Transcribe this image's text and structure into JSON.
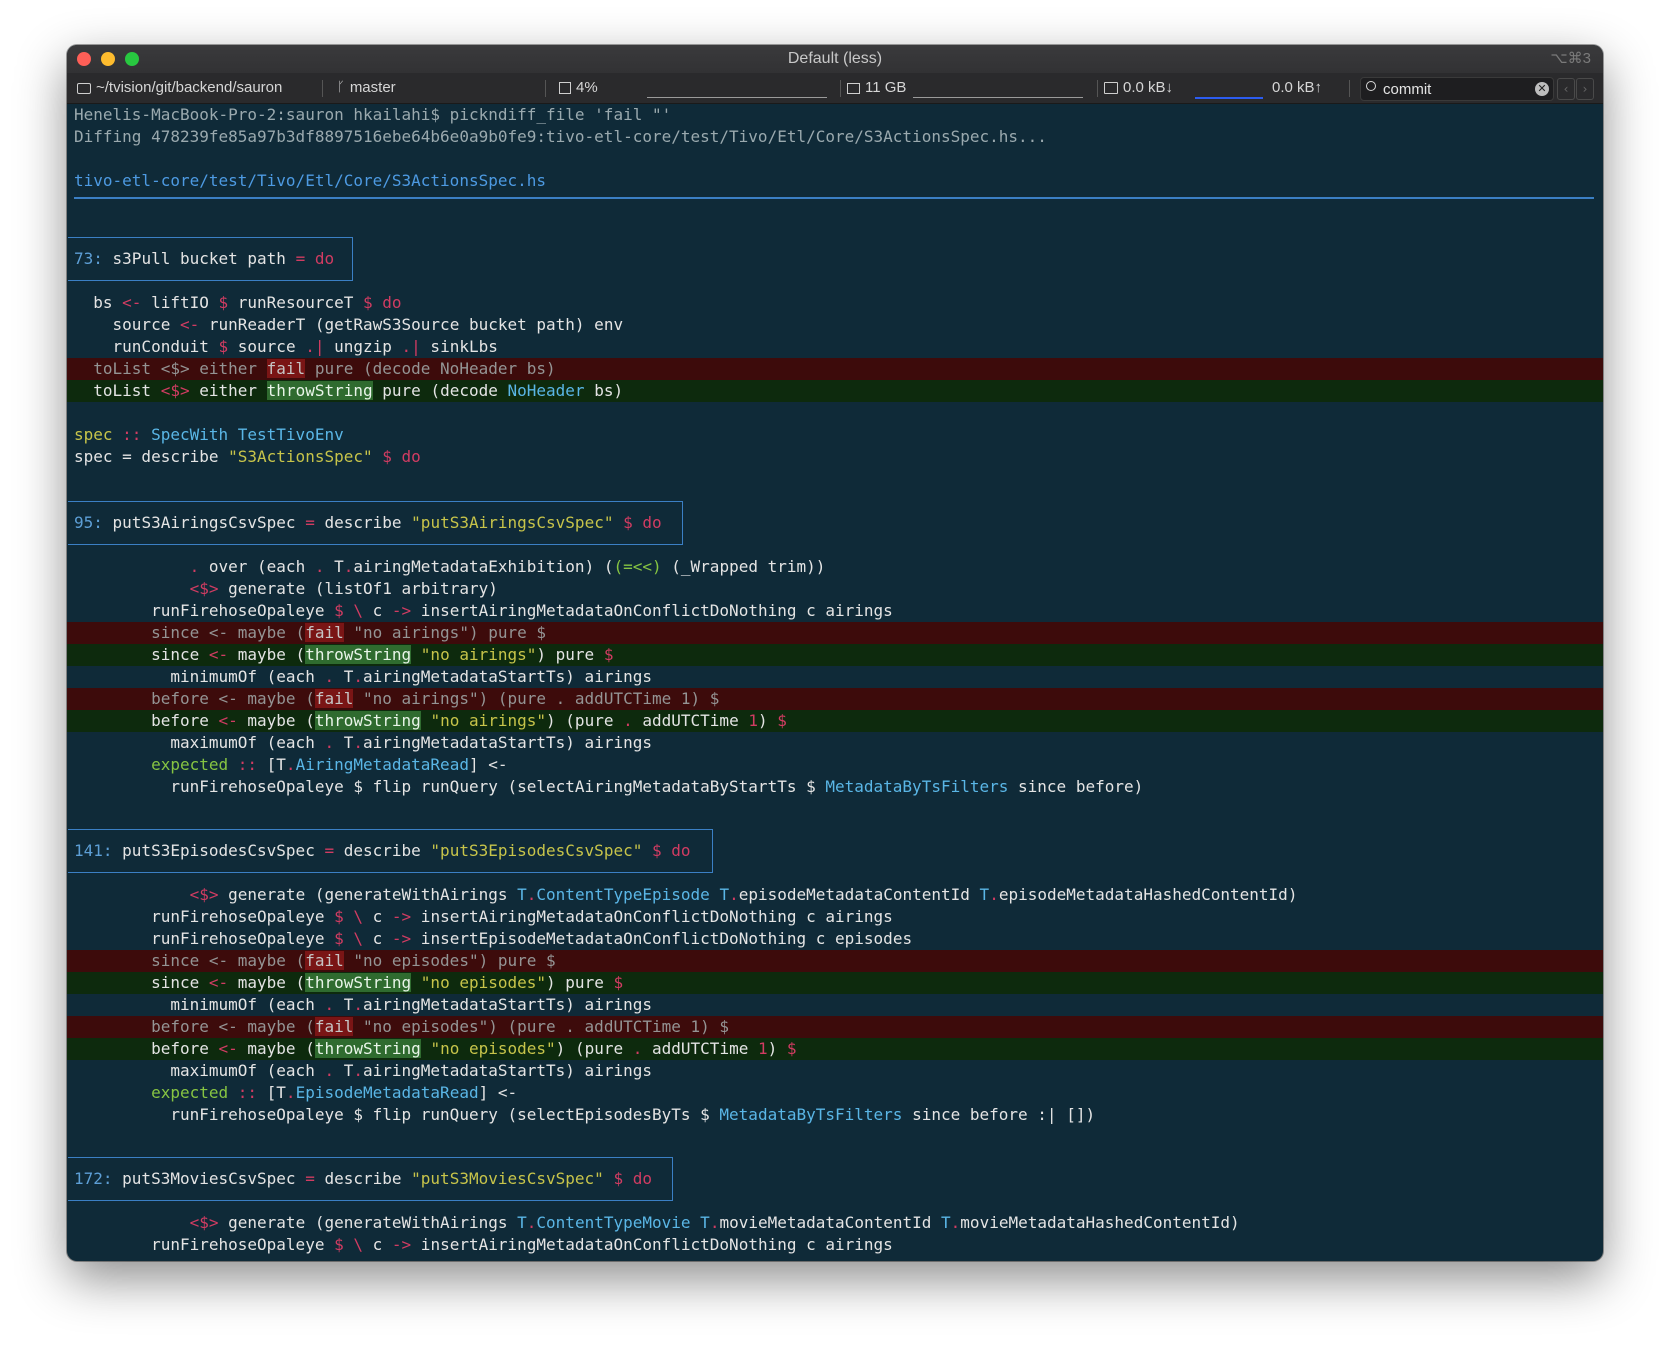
{
  "window": {
    "title": "Default (less)",
    "shortcut": "⌥⌘3"
  },
  "statusbar": {
    "path": "~/tvision/git/backend/sauron",
    "branch": "master",
    "cpu": "4%",
    "memory": "11 GB",
    "net_down": "0.0 kB↓",
    "net_up": "0.0 kB↑",
    "search_value": "commit",
    "clear_glyph": "✕",
    "nav_back": "‹",
    "nav_forward": "›"
  },
  "colors": {
    "background": "#0f2a38",
    "deleted_bg": "#3d0b0b",
    "added_bg": "#0d2a0d",
    "rule": "#3b7fc4"
  },
  "terminal": {
    "prompt": "Henelis-MacBook-Pro-2:sauron hkailahi$ pickndiff_file 'fail \"'",
    "diffing": "Diffing 478239fe85a97b3df8897516ebe64b6e0a9b0fe9:tivo-etl-core/test/Tivo/Etl/Core/S3ActionsSpec.hs...",
    "filename": "tivo-etl-core/test/Tivo/Etl/Core/S3ActionsSpec.hs",
    "hunk1": {
      "num": "73:",
      "text": " s3Pull bucket path ",
      "do": "= do"
    },
    "h1": {
      "l1a": "  bs ",
      "l1b": "<-",
      "l1c": " liftIO ",
      "l1d": "$",
      "l1e": " runResourceT ",
      "l1f": "$ do",
      "l2a": "    source ",
      "l2b": "<-",
      "l2c": " runReaderT (getRawS3Source bucket path) env",
      "l3a": "    runConduit ",
      "l3b": "$",
      "l3c": " source ",
      "l3d": ".|",
      "l3e": " ungzip ",
      "l3f": ".|",
      "l3g": " sinkLbs",
      "del1a": "  toList <$> either ",
      "del1b": "fail",
      "del1c": " pure (decode NoHeader bs)",
      "add1a": "  toList ",
      "add1b": "<$>",
      "add1c": " either ",
      "add1d": "throwString",
      "add1e": " pure (decode ",
      "add1f": "NoHeader",
      "add1g": " bs)",
      "spec1a": "spec",
      "spec1b": " :: ",
      "spec1c": "SpecWith TestTivoEnv",
      "spec2a": "spec = describe ",
      "spec2b": "\"S3ActionsSpec\"",
      "spec2c": " $ do"
    },
    "hunk2": {
      "num": "95:",
      "text": " putS3AiringsCsvSpec ",
      "eq": "=",
      "desc": " describe ",
      "str": "\"putS3AiringsCsvSpec\"",
      "tail": " $ do"
    },
    "h2": {
      "l1a": "            ",
      "l1b": ".",
      "l1c": " over (each ",
      "l1d": ".",
      "l1e": " T",
      "l1f": ".",
      "l1g": "airingMetadataExhibition) (",
      "l1h": "(=<<)",
      "l1i": " (_Wrapped trim))",
      "l2a": "            ",
      "l2b": "<$>",
      "l2c": " generate (listOf1 arbitrary)",
      "l3a": "        runFirehoseOpaleye ",
      "l3b": "$ \\",
      "l3c": " c ",
      "l3d": "->",
      "l3e": " insertAiringMetadataOnConflictDoNothing c airings",
      "del1a": "        since <- maybe (",
      "del1b": "fail",
      "del1c": " \"no airings\") pure $",
      "add1a": "        since ",
      "add1b": "<-",
      "add1c": " maybe (",
      "add1d": "throwString",
      "add1e": " ",
      "add1f": "\"no airings\"",
      "add1g": ") pure ",
      "add1h": "$",
      "l4a": "          minimumOf (each ",
      "l4b": ".",
      "l4c": " T",
      "l4d": ".",
      "l4e": "airingMetadataStartTs) airings",
      "del2a": "        before <- maybe (",
      "del2b": "fail",
      "del2c": " \"no airings\") (pure . addUTCTime 1) $",
      "add2a": "        before ",
      "add2b": "<-",
      "add2c": " maybe (",
      "add2d": "throwString",
      "add2e": " ",
      "add2f": "\"no airings\"",
      "add2g": ") (pure ",
      "add2h": ".",
      "add2i": " addUTCTime ",
      "add2j": "1",
      "add2k": ") ",
      "add2l": "$",
      "l5a": "          maximumOf (each ",
      "l5b": ".",
      "l5c": " T",
      "l5d": ".",
      "l5e": "airingMetadataStartTs) airings",
      "l6a": "        expected",
      "l6b": " :: ",
      "l6c": "[T",
      "l6d": ".",
      "l6e": "AiringMetadataRead",
      "l6f": "] <-",
      "l7a": "          runFirehoseOpaleye $ flip runQuery (selectAiringMetadataByStartTs $ ",
      "l7b": "MetadataByTsFilters",
      "l7c": " since before)"
    },
    "hunk3": {
      "num": "141:",
      "text": " putS3EpisodesCsvSpec ",
      "eq": "=",
      "desc": " describe ",
      "str": "\"putS3EpisodesCsvSpec\"",
      "tail": " $ do"
    },
    "h3": {
      "l1a": "            ",
      "l1b": "<$>",
      "l1c": " generate (generateWithAirings ",
      "l1d": "T",
      "l1e": ".",
      "l1f": "ContentTypeEpisode",
      "l1g": " ",
      "l1h": "T",
      "l1i": ".",
      "l1j": "episodeMetadataContentId ",
      "l1k": "T",
      "l1l": ".",
      "l1m": "episodeMetadataHashedContentId)",
      "l2a": "        runFirehoseOpaleye ",
      "l2b": "$ \\",
      "l2c": " c ",
      "l2d": "->",
      "l2e": " insertAiringMetadataOnConflictDoNothing c airings",
      "l3a": "        runFirehoseOpaleye ",
      "l3b": "$ \\",
      "l3c": " c ",
      "l3d": "->",
      "l3e": " insertEpisodeMetadataOnConflictDoNothing c episodes",
      "del1a": "        since <- maybe (",
      "del1b": "fail",
      "del1c": " \"no episodes\") pure $",
      "add1a": "        since ",
      "add1b": "<-",
      "add1c": " maybe (",
      "add1d": "throwString",
      "add1e": " ",
      "add1f": "\"no episodes\"",
      "add1g": ") pure ",
      "add1h": "$",
      "l4a": "          minimumOf (each ",
      "l4b": ".",
      "l4c": " T",
      "l4d": ".",
      "l4e": "airingMetadataStartTs) airings",
      "del2a": "        before <- maybe (",
      "del2b": "fail",
      "del2c": " \"no episodes\") (pure . addUTCTime 1) $",
      "add2a": "        before ",
      "add2b": "<-",
      "add2c": " maybe (",
      "add2d": "throwString",
      "add2e": " ",
      "add2f": "\"no episodes\"",
      "add2g": ") (pure ",
      "add2h": ".",
      "add2i": " addUTCTime ",
      "add2j": "1",
      "add2k": ") ",
      "add2l": "$",
      "l5a": "          maximumOf (each ",
      "l5b": ".",
      "l5c": " T",
      "l5d": ".",
      "l5e": "airingMetadataStartTs) airings",
      "l6a": "        expected",
      "l6b": " :: ",
      "l6c": "[T",
      "l6d": ".",
      "l6e": "EpisodeMetadataRead",
      "l6f": "] <-",
      "l7a": "          runFirehoseOpaleye $ flip runQuery (selectEpisodesByTs $ ",
      "l7b": "MetadataByTsFilters",
      "l7c": " since before :| [])"
    },
    "hunk4": {
      "num": "172:",
      "text": " putS3MoviesCsvSpec ",
      "eq": "=",
      "desc": " describe ",
      "str": "\"putS3MoviesCsvSpec\"",
      "tail": " $ do"
    },
    "h4": {
      "l1a": "            ",
      "l1b": "<$>",
      "l1c": " generate (generateWithAirings ",
      "l1d": "T",
      "l1e": ".",
      "l1f": "ContentTypeMovie",
      "l1g": " ",
      "l1h": "T",
      "l1i": ".",
      "l1j": "movieMetadataContentId ",
      "l1k": "T",
      "l1l": ".",
      "l1m": "movieMetadataHashedContentId)",
      "l2a": "        runFirehoseOpaleye ",
      "l2b": "$ \\",
      "l2c": " c ",
      "l2d": "->",
      "l2e": " insertAiringMetadataOnConflictDoNothing c airings"
    }
  }
}
